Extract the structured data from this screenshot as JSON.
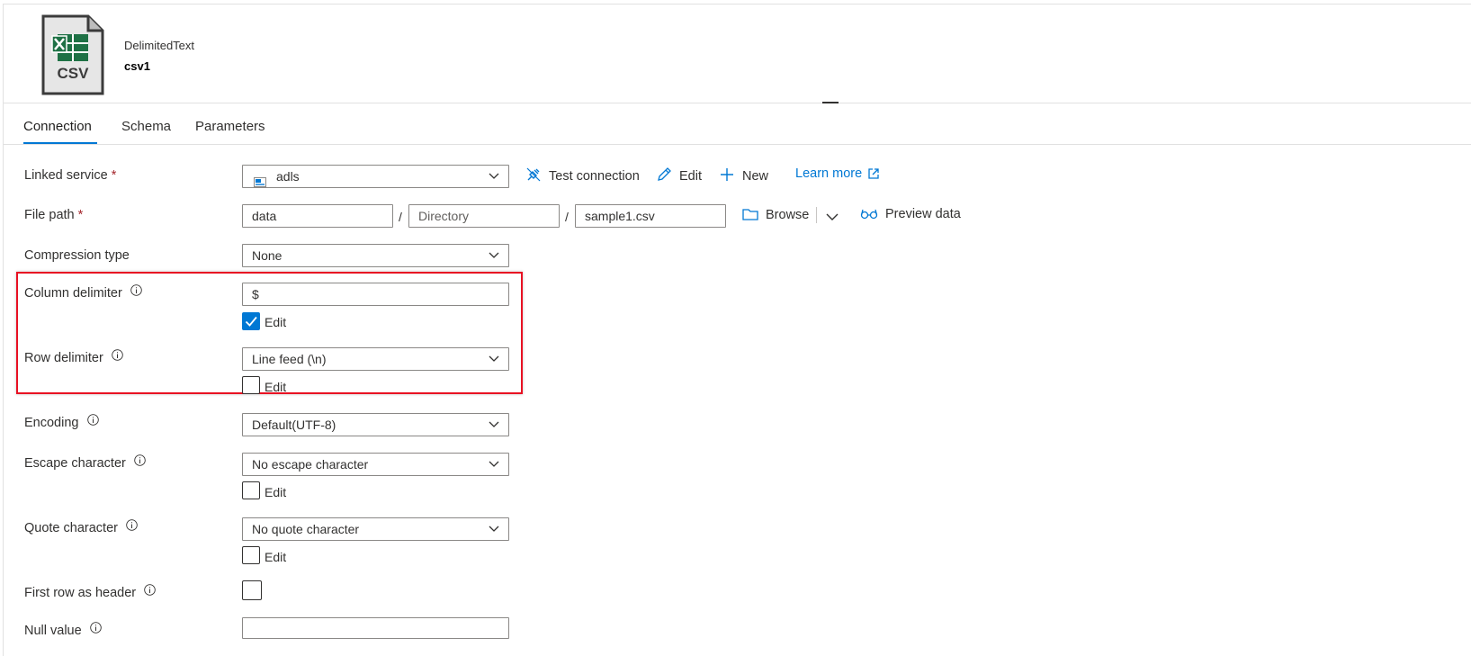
{
  "header": {
    "icon": "csv-file-icon",
    "icon_label": "CSV",
    "dataset_type": "DelimitedText",
    "dataset_name": "csv1"
  },
  "tabs": [
    {
      "label": "Connection",
      "active": true
    },
    {
      "label": "Schema",
      "active": false
    },
    {
      "label": "Parameters",
      "active": false
    }
  ],
  "form": {
    "linked_service": {
      "label": "Linked service",
      "required_mark": "*",
      "value": "adls",
      "actions": {
        "test_connection": "Test connection",
        "edit": "Edit",
        "new": "New",
        "learn_more": "Learn more"
      }
    },
    "file_path": {
      "label": "File path",
      "required_mark": "*",
      "container": "data",
      "directory_placeholder": "Directory",
      "file": "sample1.csv",
      "separator": "/",
      "browse": "Browse",
      "preview": "Preview data"
    },
    "compression_type": {
      "label": "Compression type",
      "value": "None"
    },
    "column_delimiter": {
      "label": "Column delimiter",
      "value": "$",
      "edit_label": "Edit",
      "edit_checked": true
    },
    "row_delimiter": {
      "label": "Row delimiter",
      "value": "Line feed (\\n)",
      "edit_label": "Edit",
      "edit_checked": false
    },
    "encoding": {
      "label": "Encoding",
      "value": "Default(UTF-8)"
    },
    "escape_character": {
      "label": "Escape character",
      "value": "No escape character",
      "edit_label": "Edit",
      "edit_checked": false
    },
    "quote_character": {
      "label": "Quote character",
      "value": "No quote character",
      "edit_label": "Edit",
      "edit_checked": false
    },
    "first_row_header": {
      "label": "First row as header",
      "checked": false
    },
    "null_value": {
      "label": "Null value",
      "value": ""
    }
  },
  "colors": {
    "accent": "#0078d4",
    "highlight": "#e81123",
    "required": "#a4262c",
    "excel_green": "#1e7145"
  }
}
